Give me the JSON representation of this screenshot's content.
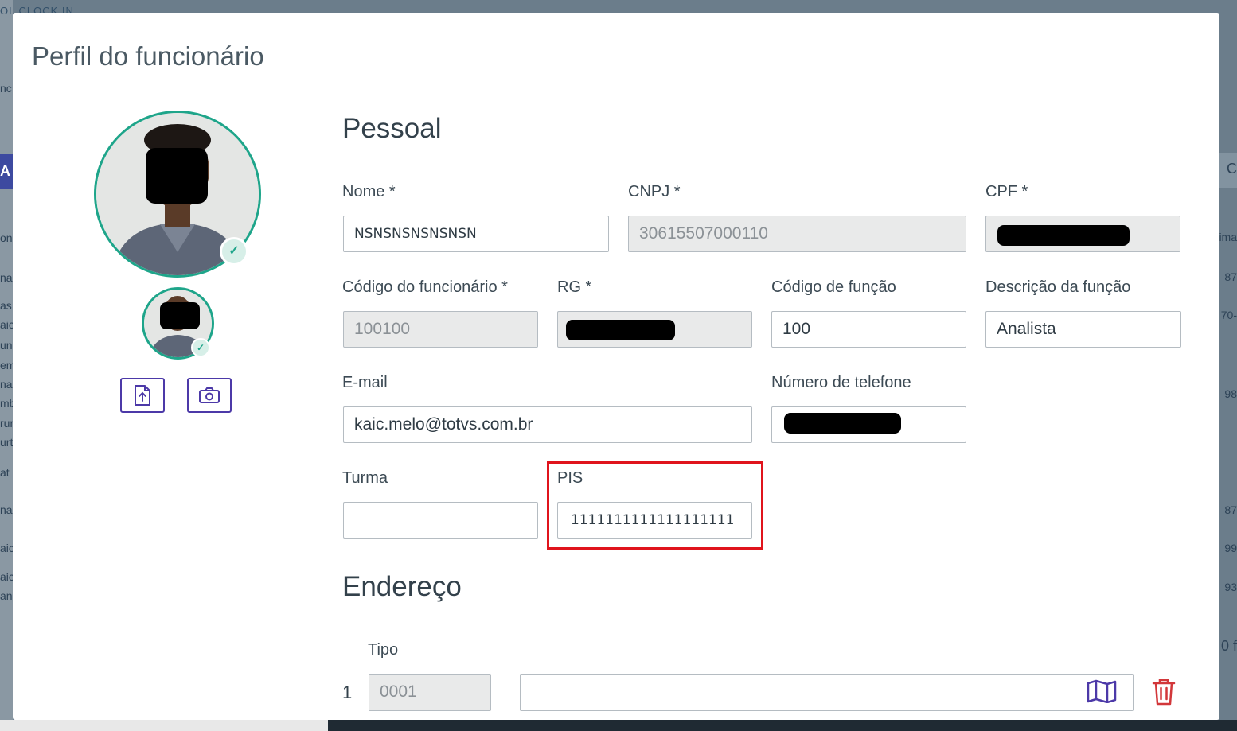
{
  "background": {
    "top_text": "OL   CLOCK IN",
    "left_glyphs": [
      "nc",
      "A",
      "on",
      "na",
      "as",
      "aic",
      "un",
      "em",
      "na",
      "mb",
      "rur",
      "urt",
      "at",
      "na",
      "aic",
      "aic",
      "an"
    ],
    "right_glyphs": [
      "C",
      "ima",
      "87",
      "70-",
      "98",
      "87",
      "99",
      "93",
      "0 f"
    ]
  },
  "modal": {
    "title": "Perfil do funcionário"
  },
  "avatar": {
    "upload_icon": "file-upload-icon",
    "camera_icon": "camera-icon",
    "check_icon": "check-icon"
  },
  "personal": {
    "title": "Pessoal",
    "nome": {
      "label": "Nome *",
      "value": "NSNSNSNSNSNSN"
    },
    "cnpj": {
      "label": "CNPJ *",
      "value": "30615507000110"
    },
    "cpf": {
      "label": "CPF *",
      "value": ""
    },
    "codigo_funcionario": {
      "label": "Código do funcionário *",
      "value": "100100"
    },
    "rg": {
      "label": "RG *",
      "value": ""
    },
    "codigo_funcao": {
      "label": "Código de função",
      "value": "100"
    },
    "descricao_funcao": {
      "label": "Descrição da função",
      "value": "Analista"
    },
    "email": {
      "label": "E-mail",
      "value": "kaic.melo@totvs.com.br"
    },
    "telefone": {
      "label": "Número de telefone",
      "value": ""
    },
    "turma": {
      "label": "Turma",
      "value": ""
    },
    "pis": {
      "label": "PIS",
      "value": "1111111111111111111"
    }
  },
  "address": {
    "title": "Endereço",
    "tipo_label": "Tipo",
    "rows": [
      {
        "index": "1",
        "tipo": "0001",
        "endereco": ""
      }
    ],
    "map_icon": "map-icon",
    "delete_icon": "trash-icon"
  },
  "colors": {
    "accent_purple": "#4c39a8",
    "avatar_ring": "#1ea58a",
    "delete_red": "#d2373a",
    "highlight_red": "#e0141c"
  }
}
